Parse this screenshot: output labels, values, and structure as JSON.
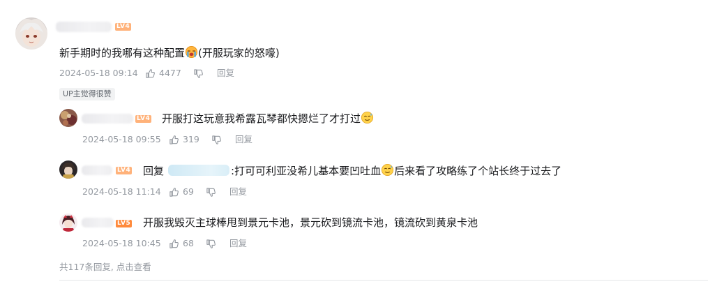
{
  "colors": {
    "text": "#18191c",
    "meta": "#9499a0",
    "level4": "#ffb27a",
    "level5": "#ff8a3c"
  },
  "comment": {
    "level": "LV4",
    "text": "新手期时的我哪有这种配置",
    "emoji_icon": "crying-emoji",
    "text_suffix": "(开服玩家的怒嚎)",
    "time": "2024-05-18 09:14",
    "likes": "4477",
    "reply_label": "回复",
    "badge": "UP主觉得很赞"
  },
  "replies": [
    {
      "level": "LV4",
      "text": "开服打这玩意我希露瓦琴都快摁烂了才打过",
      "emoji_icon": "sweat-emoji",
      "time": "2024-05-18 09:55",
      "likes": "319",
      "reply_label": "回复"
    },
    {
      "level": "LV4",
      "reply_prefix": "回复",
      "text": ":打可可利亚没希儿基本要凹吐血",
      "emoji_icon": "sweat-emoji",
      "text_suffix": "后来看了攻略练了个站长终于过去了",
      "time": "2024-05-18 11:14",
      "likes": "69",
      "reply_label": "回复"
    },
    {
      "level": "LV5",
      "text": "开服我毁灭主球棒甩到景元卡池，景元砍到镜流卡池，镜流砍到黄泉卡池",
      "time": "2024-05-18 10:45",
      "likes": "68",
      "reply_label": "回复"
    }
  ],
  "footer": {
    "text": "共117条回复, 点击查看"
  }
}
